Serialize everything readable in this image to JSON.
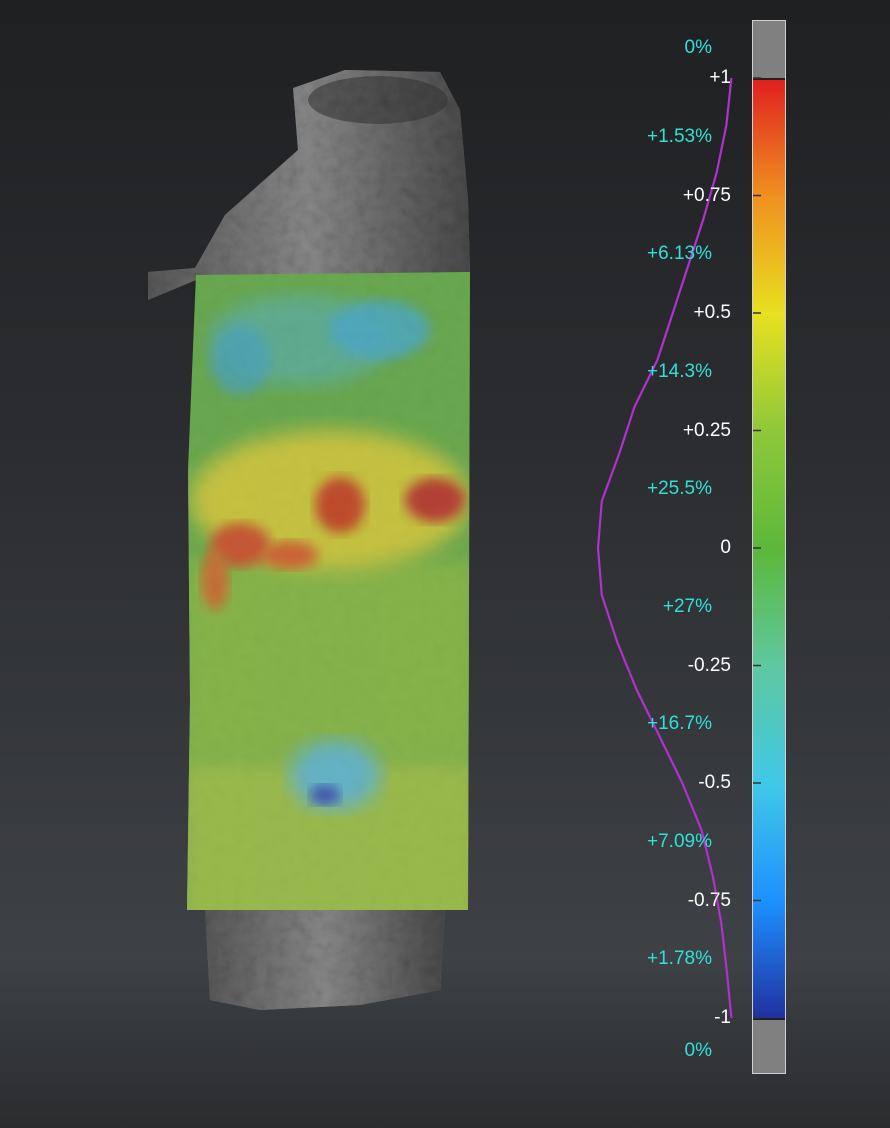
{
  "colors": {
    "background_top": "#1f2022",
    "background_bottom": "#3e4145",
    "tick_label": "#ffffff",
    "percent_label": "#30e0d8",
    "distribution_curve": "#b030d0",
    "out_of_range": "#808080"
  },
  "chart_data": {
    "type": "heatmap",
    "title": "",
    "xlabel": "",
    "ylabel": "",
    "colormap": [
      "#2030a0",
      "#1e90ff",
      "#40c8e8",
      "#5ec8a0",
      "#5cb83a",
      "#8ec83a",
      "#e8e020",
      "#f09020",
      "#e02020"
    ],
    "scale_range": [
      -1,
      1
    ],
    "tick_labels": [
      "+1",
      "+0.75",
      "+0.5",
      "+0.25",
      "0",
      "-0.25",
      "-0.5",
      "-0.75",
      "-1"
    ],
    "tick_values": [
      1,
      0.75,
      0.5,
      0.25,
      0,
      -0.25,
      -0.5,
      -0.75,
      -1
    ],
    "bin_percent_labels": [
      "0%",
      "+1.53%",
      "+6.13%",
      "+14.3%",
      "+25.5%",
      "+27%",
      "+16.7%",
      "+7.09%",
      "+1.78%",
      "0%"
    ],
    "bin_percent_values": [
      0,
      1.53,
      6.13,
      14.3,
      25.5,
      27,
      16.7,
      7.09,
      1.78,
      0
    ],
    "bin_centers": [
      1.125,
      0.875,
      0.625,
      0.375,
      0.125,
      -0.125,
      -0.375,
      -0.625,
      -0.875,
      -1.125
    ],
    "distribution_curve": {
      "y": [
        1.0,
        0.9,
        0.8,
        0.7,
        0.6,
        0.5,
        0.4,
        0.3,
        0.2,
        0.1,
        0.0,
        -0.1,
        -0.2,
        -0.3,
        -0.4,
        -0.5,
        -0.6,
        -0.7,
        -0.8,
        -0.9,
        -1.0
      ],
      "value": [
        1.2,
        2.5,
        5.0,
        8.5,
        12.5,
        16.5,
        20.5,
        26.5,
        30.5,
        35.0,
        36.0,
        35.0,
        31.0,
        26.0,
        20.0,
        14.0,
        9.0,
        6.0,
        3.8,
        2.4,
        1.2
      ]
    }
  }
}
